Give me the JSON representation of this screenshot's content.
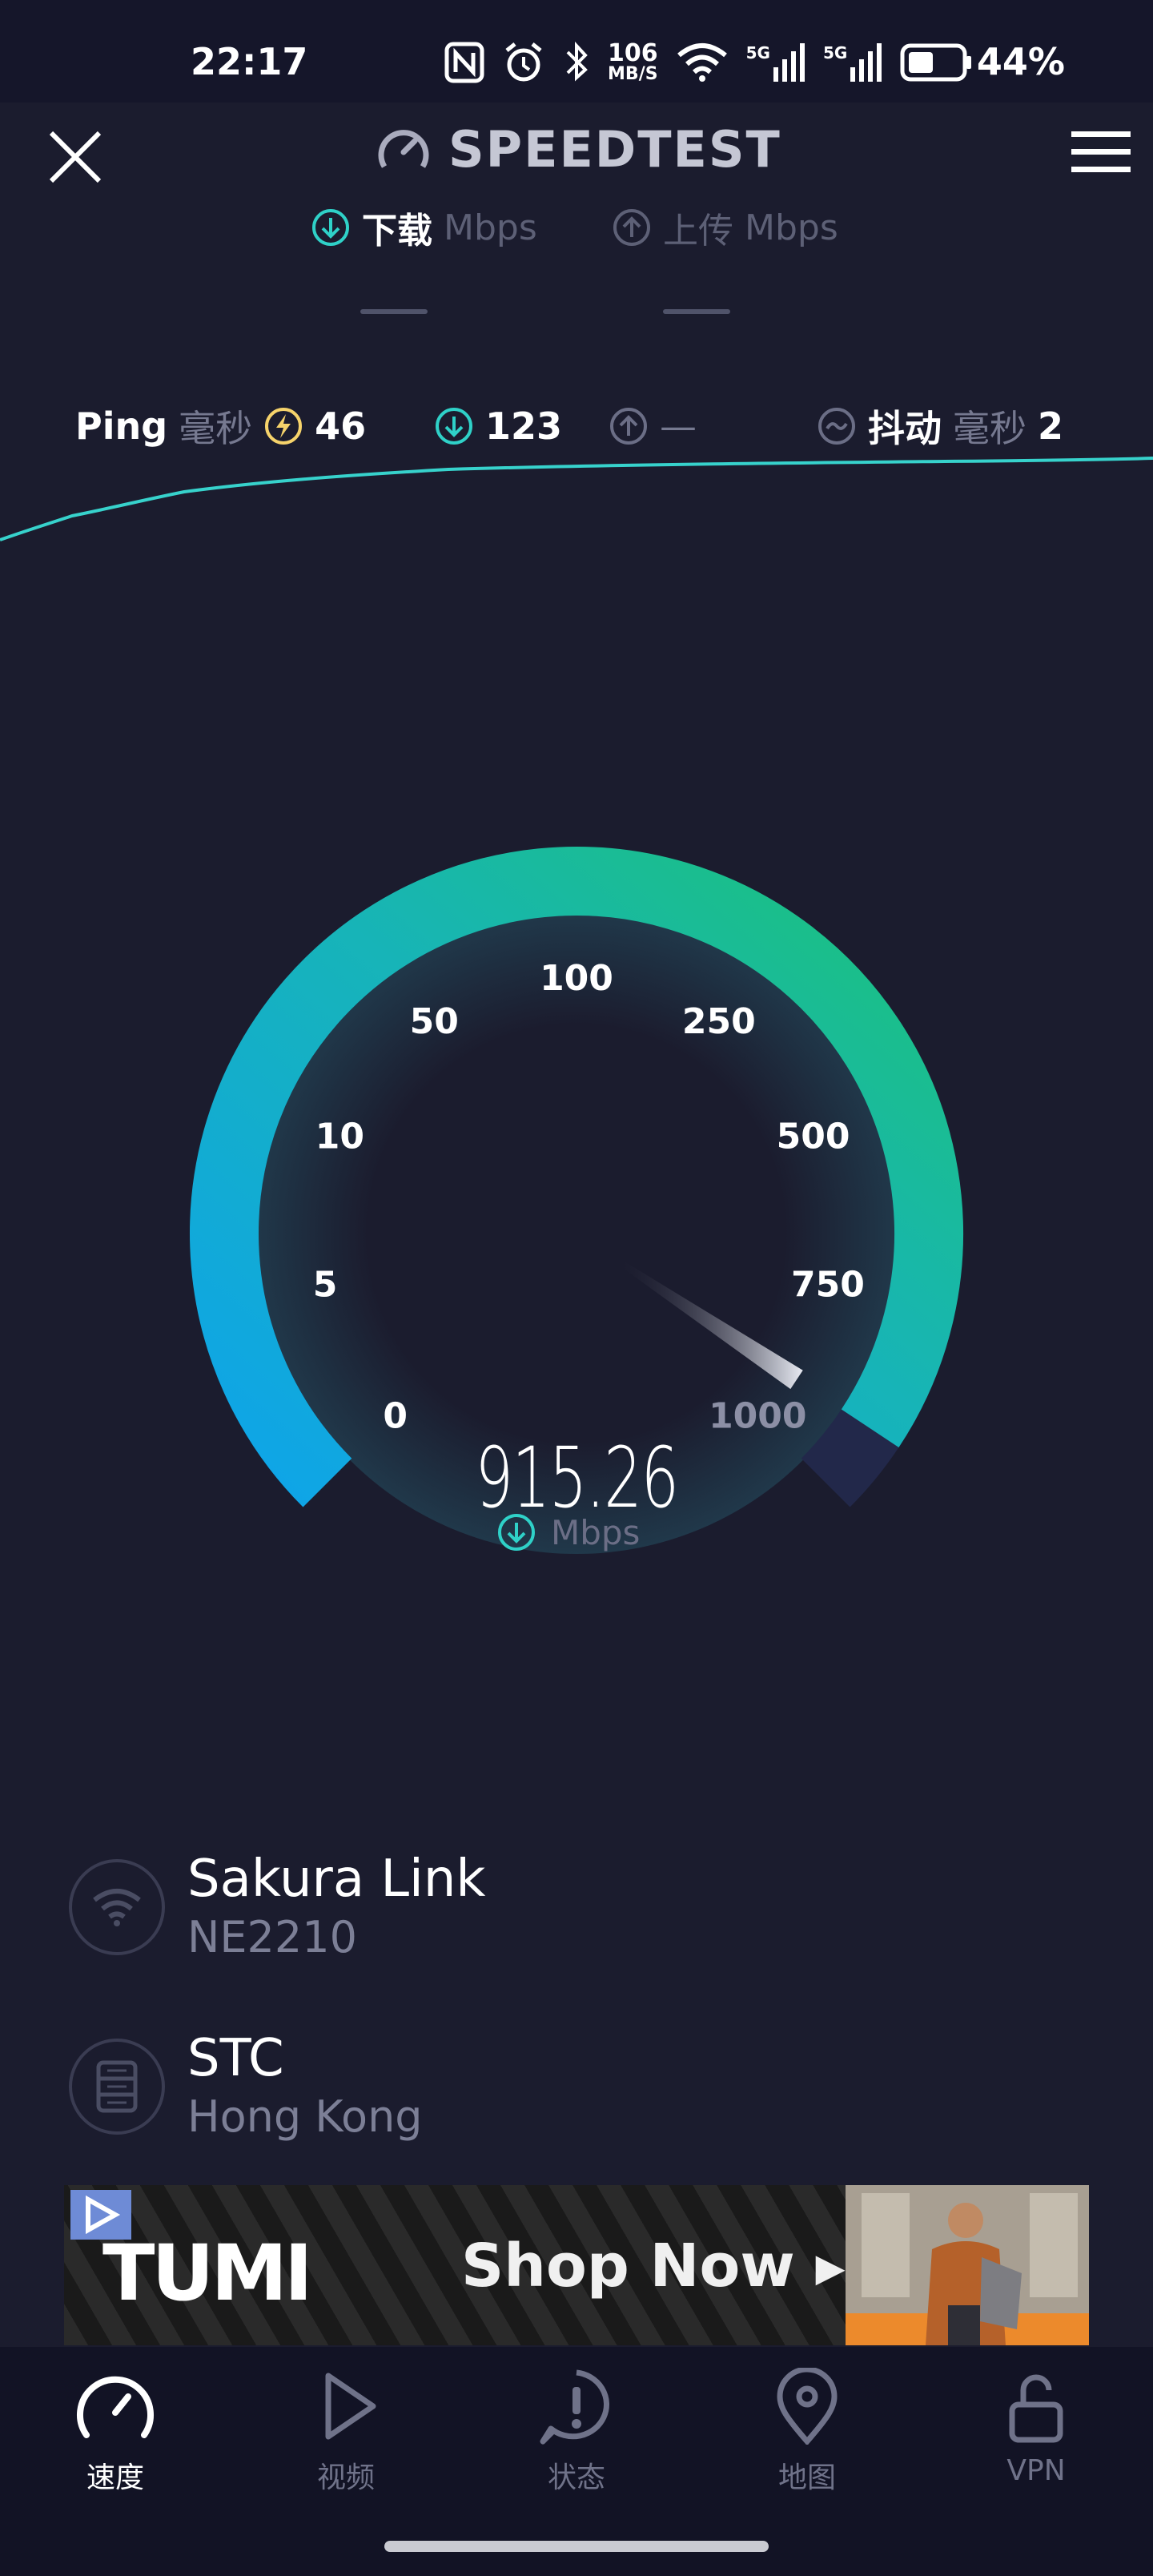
{
  "status_bar": {
    "time": "22:17",
    "net_speed_value": "106",
    "net_speed_unit": "MB/S",
    "network_1": "5G",
    "network_2": "5G",
    "battery": "44%"
  },
  "header": {
    "brand": "SPEEDTEST",
    "download_tab": {
      "label": "下载",
      "unit": "Mbps"
    },
    "upload_tab": {
      "label": "上传",
      "unit": "Mbps"
    }
  },
  "stats": {
    "ping_label": "Ping",
    "ping_unit": "毫秒",
    "ping_value": "46",
    "download_value": "123",
    "upload_value": "—",
    "jitter_label": "抖动",
    "jitter_unit": "毫秒",
    "jitter_value": "2"
  },
  "gauge": {
    "labels": [
      "0",
      "5",
      "10",
      "50",
      "100",
      "250",
      "500",
      "750",
      "1000"
    ],
    "reading": "915.26",
    "reading_unit": "Mbps",
    "max": 1000
  },
  "connection": {
    "provider": "Sakura Link",
    "device": "NE2210",
    "server_name": "STC",
    "server_location": "Hong Kong"
  },
  "ad": {
    "brand": "TUMI",
    "cta": "Shop Now ▸"
  },
  "nav": [
    {
      "label": "速度",
      "icon": "speedometer-icon",
      "active": true
    },
    {
      "label": "视频",
      "icon": "play-icon",
      "active": false
    },
    {
      "label": "状态",
      "icon": "alert-icon",
      "active": false
    },
    {
      "label": "地图",
      "icon": "map-pin-icon",
      "active": false
    },
    {
      "label": "VPN",
      "icon": "unlock-icon",
      "active": false
    }
  ],
  "colors": {
    "background": "#1b1c2e",
    "accent_teal": "#15b8a6",
    "accent_blue": "#12a2e8",
    "accent_green": "#1cc07c"
  }
}
